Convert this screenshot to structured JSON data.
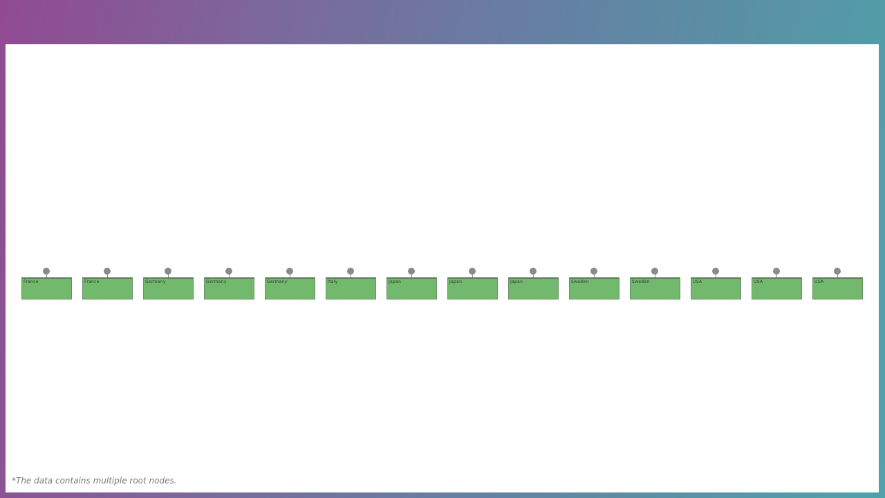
{
  "nodes": [
    {
      "label": "France"
    },
    {
      "label": "France"
    },
    {
      "label": "Germany"
    },
    {
      "label": "Germany"
    },
    {
      "label": "Germany"
    },
    {
      "label": "Italy"
    },
    {
      "label": "Japan"
    },
    {
      "label": "Japan"
    },
    {
      "label": "Japan"
    },
    {
      "label": "Sweden"
    },
    {
      "label": "Sweden"
    },
    {
      "label": "USA"
    },
    {
      "label": "USA"
    },
    {
      "label": "USA"
    }
  ],
  "footnote": "*The data contains multiple root nodes.",
  "colors": {
    "node_fill": "#72b86d",
    "handle": "#8a8a8a",
    "gradient_start": "#914a92",
    "gradient_end": "#4fa3aa"
  }
}
